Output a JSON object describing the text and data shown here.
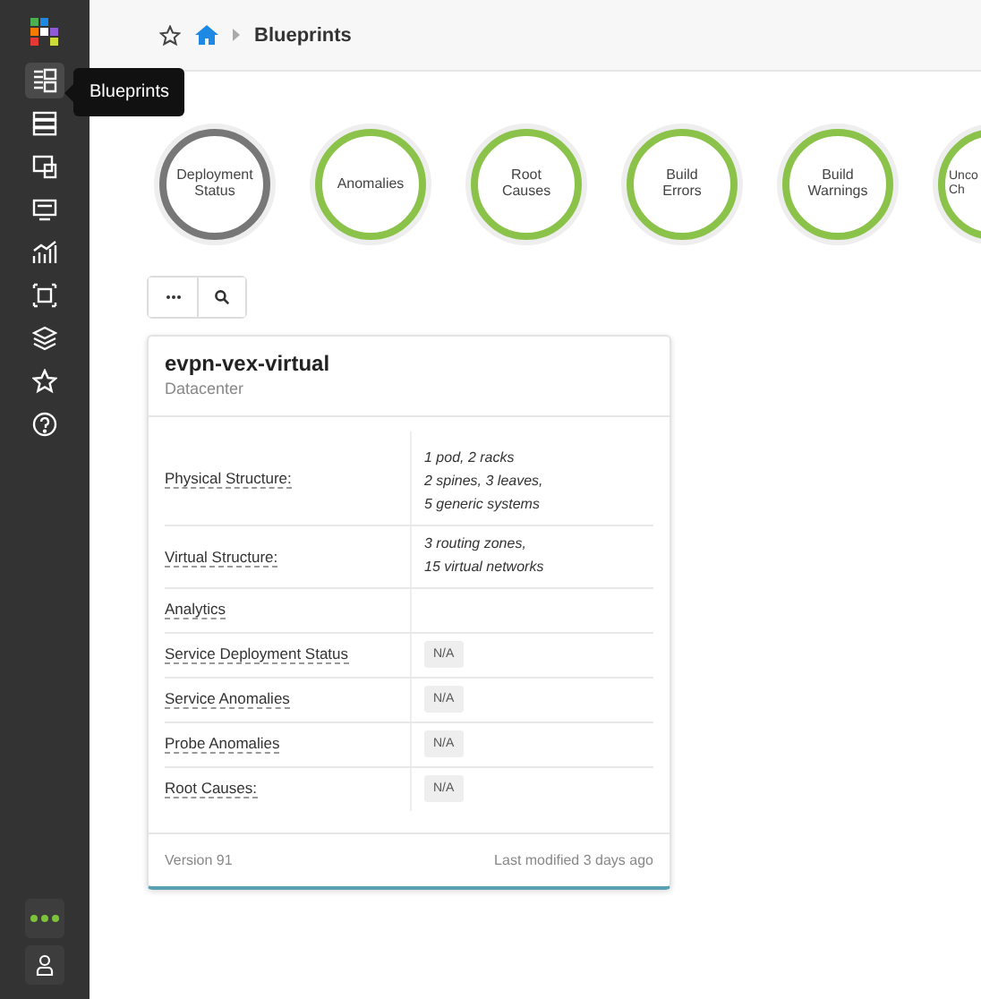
{
  "sidebar": {
    "items": [
      {
        "selected": true
      },
      {
        "selected": false
      },
      {
        "selected": false
      },
      {
        "selected": false
      },
      {
        "selected": false
      },
      {
        "selected": false
      },
      {
        "selected": false
      },
      {
        "selected": false
      },
      {
        "selected": false
      }
    ],
    "tooltip": "Blueprints"
  },
  "breadcrumb": {
    "current": "Blueprints"
  },
  "status_circles": [
    {
      "lines": [
        "Deployment",
        "Status"
      ],
      "color": "#777777"
    },
    {
      "lines": [
        "Anomalies"
      ],
      "color": "#8bc34a"
    },
    {
      "lines": [
        "Root",
        "Causes"
      ],
      "color": "#8bc34a"
    },
    {
      "lines": [
        "Build",
        "Errors"
      ],
      "color": "#8bc34a"
    },
    {
      "lines": [
        "Build",
        "Warnings"
      ],
      "color": "#8bc34a"
    },
    {
      "lines": [
        "Unco",
        "Ch"
      ],
      "color": "#8bc34a"
    }
  ],
  "card": {
    "title": "evpn-vex-virtual",
    "subtitle": "Datacenter",
    "rows": [
      {
        "label": "Physical Structure:",
        "kind": "text",
        "lines": [
          "1 pod, 2 racks",
          "2 spines, 3 leaves,",
          "5 generic systems"
        ]
      },
      {
        "label": "Virtual Structure:",
        "kind": "text",
        "lines": [
          "3 routing zones,",
          "15 virtual networks"
        ]
      },
      {
        "label": "Analytics",
        "kind": "empty"
      },
      {
        "label": "Service Deployment Status",
        "kind": "badge",
        "value": "N/A"
      },
      {
        "label": "Service Anomalies",
        "kind": "badge",
        "value": "N/A"
      },
      {
        "label": "Probe Anomalies",
        "kind": "badge",
        "value": "N/A"
      },
      {
        "label": "Root Causes:",
        "kind": "badge",
        "value": "N/A"
      }
    ],
    "version": "Version 91",
    "modified": "Last modified 3 days ago"
  }
}
